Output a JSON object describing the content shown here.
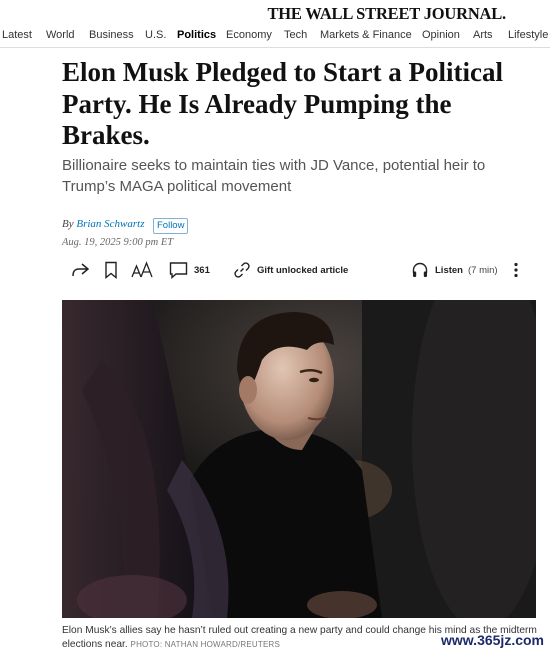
{
  "masthead": {
    "title": "THE WALL STREET JOURNAL."
  },
  "nav": {
    "items": [
      "Latest",
      "World",
      "Business",
      "U.S.",
      "Politics",
      "Economy",
      "Tech",
      "Markets & Finance",
      "Opinion",
      "Arts",
      "Lifestyle"
    ],
    "active": "Politics"
  },
  "article": {
    "headline": "Elon Musk Pledged to Start a Political Party. He Is Already Pumping the Brakes.",
    "dek": "Billionaire seeks to maintain ties with JD Vance, potential heir to Trump’s MAGA political movement",
    "byline_prefix": "By",
    "author": "Brian Schwartz",
    "follow_label": "Follow",
    "date": "Aug. 19, 2025 9:00 pm ET"
  },
  "toolbar": {
    "comment_count": "361",
    "gift_label": "Gift unlocked article",
    "listen_label": "Listen",
    "listen_duration": "(7 min)"
  },
  "photo": {
    "caption": "Elon Musk’s allies say he hasn’t ruled out creating a new party and could change his mind as the midterm elections near.",
    "credit": "PHOTO: NATHAN HOWARD/REUTERS"
  },
  "watermark": "www.365jz.com",
  "icons": [
    "share-icon",
    "bookmark-icon",
    "text-size-icon",
    "comment-icon",
    "gift-link-icon",
    "headphones-icon",
    "more-vertical-icon"
  ],
  "colors": {
    "link": "#0274b6",
    "text": "#111111",
    "dek": "#555555"
  }
}
